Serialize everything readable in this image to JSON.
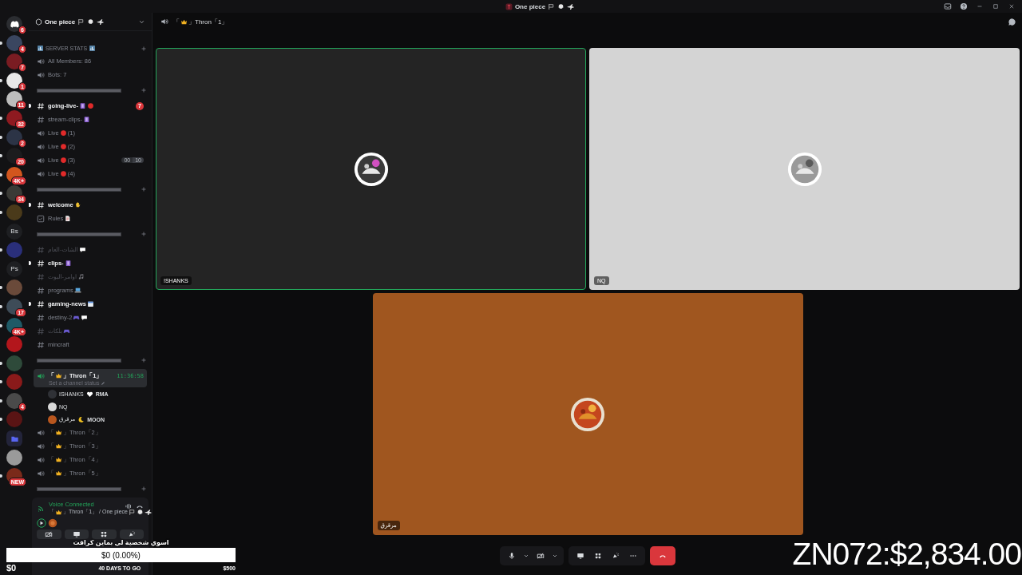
{
  "window": {
    "title": "One piece"
  },
  "servers": [
    {
      "kind": "home",
      "badge": "6",
      "unread": false,
      "color": "#2b2d31"
    },
    {
      "kind": "avatar",
      "badge": "4",
      "unread": true,
      "color": "#3a4660"
    },
    {
      "kind": "avatar",
      "badge": "7",
      "unread": false,
      "color": "#7a1c22"
    },
    {
      "kind": "avatar",
      "badge": "1",
      "unread": true,
      "color": "#e8e8e8"
    },
    {
      "kind": "avatar",
      "badge": "11",
      "unread": false,
      "color": "#bdbdbd"
    },
    {
      "kind": "avatar",
      "badge": "32",
      "unread": true,
      "color": "#8e1a20"
    },
    {
      "kind": "avatar",
      "badge": "2",
      "unread": true,
      "color": "#2c3446"
    },
    {
      "kind": "avatar",
      "badge": "20",
      "unread": true,
      "color": "#1c1c1e"
    },
    {
      "kind": "avatar",
      "badge": "4K+",
      "unread": true,
      "color": "#d2561e"
    },
    {
      "kind": "avatar",
      "badge": "34",
      "unread": true,
      "color": "#3a3a36"
    },
    {
      "kind": "avatar",
      "unread": true,
      "color": "#4a3a1a"
    },
    {
      "kind": "text",
      "label": "Bs",
      "unread": false,
      "color": "#1e1f22"
    },
    {
      "kind": "avatar",
      "unread": true,
      "color": "#2a2f7a"
    },
    {
      "kind": "text",
      "label": "Ps",
      "unread": false,
      "color": "#1e1f22"
    },
    {
      "kind": "avatar",
      "unread": true,
      "color": "#6a4a3a"
    },
    {
      "kind": "avatar",
      "badge": "17",
      "unread": true,
      "color": "#3e4c58"
    },
    {
      "kind": "avatar",
      "badge": "4K+",
      "unread": true,
      "color": "#1f5a66"
    },
    {
      "kind": "avatar",
      "unread": false,
      "color": "#b3161c"
    },
    {
      "kind": "avatar",
      "unread": true,
      "color": "#2e4a3a"
    },
    {
      "kind": "avatar",
      "unread": true,
      "color": "#8a1a1a"
    },
    {
      "kind": "avatar",
      "badge": "4",
      "unread": true,
      "color": "#4a4a4a"
    },
    {
      "kind": "avatar",
      "unread": true,
      "color": "#5a1414"
    },
    {
      "kind": "folder",
      "unread": false,
      "color": "#23243a"
    },
    {
      "kind": "avatar",
      "unread": false,
      "color": "#9a9a9a"
    },
    {
      "kind": "avatar",
      "badge": "NEW",
      "unread": true,
      "color": "#7a2a1a"
    }
  ],
  "sidebar": {
    "server_name": "One piece",
    "channels": [
      {
        "kind": "category",
        "texts": [
          "SERVER STATS"
        ]
      },
      {
        "kind": "voice",
        "unread": false,
        "muted": false,
        "texts": [
          "All Members: 86"
        ]
      },
      {
        "kind": "voice",
        "unread": false,
        "muted": false,
        "texts": [
          "Bots: 7"
        ]
      },
      {
        "kind": "divider"
      },
      {
        "kind": "text",
        "unread": true,
        "muted": false,
        "badge": "7",
        "texts": [
          "going-live-"
        ]
      },
      {
        "kind": "text",
        "unread": false,
        "muted": false,
        "texts": [
          "stream-clips-"
        ]
      },
      {
        "kind": "voice",
        "unread": false,
        "muted": false,
        "texts": [
          "Live",
          "(1)"
        ]
      },
      {
        "kind": "voice",
        "unread": false,
        "muted": false,
        "texts": [
          "Live",
          "(2)"
        ]
      },
      {
        "kind": "voice",
        "unread": false,
        "muted": false,
        "texts": [
          "Live",
          "(3)"
        ],
        "count": [
          "00",
          "10"
        ]
      },
      {
        "kind": "voice",
        "unread": false,
        "muted": false,
        "texts": [
          "Live",
          "(4)"
        ]
      },
      {
        "kind": "divider"
      },
      {
        "kind": "text",
        "unread": true,
        "muted": false,
        "texts": [
          "welcome"
        ]
      },
      {
        "kind": "rules",
        "unread": false,
        "muted": false,
        "texts": [
          "Rules"
        ]
      },
      {
        "kind": "divider"
      },
      {
        "kind": "text",
        "unread": false,
        "muted": true,
        "texts": [
          "الشات-العام"
        ]
      },
      {
        "kind": "text",
        "unread": true,
        "muted": false,
        "texts": [
          "clips-"
        ]
      },
      {
        "kind": "text",
        "unread": false,
        "muted": true,
        "texts": [
          "اوامر-البوت"
        ]
      },
      {
        "kind": "text",
        "unread": false,
        "muted": false,
        "texts": [
          "programs"
        ]
      },
      {
        "kind": "text",
        "unread": true,
        "muted": false,
        "texts": [
          "gaming-news"
        ]
      },
      {
        "kind": "text",
        "unread": false,
        "muted": false,
        "texts": [
          "destiny-2"
        ]
      },
      {
        "kind": "text",
        "unread": false,
        "muted": true,
        "texts": [
          "بلكات"
        ]
      },
      {
        "kind": "text",
        "unread": false,
        "muted": false,
        "texts": [
          "mincraft"
        ]
      },
      {
        "kind": "divider"
      },
      {
        "kind": "voice",
        "selected": true,
        "unread": true,
        "muted": false,
        "texts": [
          "「",
          "」Thron「1」"
        ],
        "time": "11:36:58",
        "status": "Set a channel status",
        "users": [
          {
            "name": "ISHANKS",
            "color": "#2f3136",
            "tag": "RMA"
          },
          {
            "name": "NQ",
            "color": "#d8d8d8"
          },
          {
            "name": "مرقرق",
            "color": "#b8561e",
            "tag": "MOON"
          }
        ]
      },
      {
        "kind": "voice",
        "selected": false,
        "unread": false,
        "muted": false,
        "texts": [
          "「",
          "」Thron「2」"
        ]
      },
      {
        "kind": "voice",
        "selected": false,
        "unread": false,
        "muted": false,
        "texts": [
          "「",
          "」Thron「3」"
        ]
      },
      {
        "kind": "voice",
        "selected": false,
        "unread": false,
        "muted": false,
        "texts": [
          "「",
          "」Thron「4」"
        ]
      },
      {
        "kind": "voice",
        "selected": false,
        "unread": false,
        "muted": false,
        "texts": [
          "「",
          "」Thron「5」"
        ]
      },
      {
        "kind": "divider"
      }
    ]
  },
  "voice_panel": {
    "title": "Voice Connected",
    "texts": [
      "「",
      "」Thron「1」 / One piece"
    ]
  },
  "main": {
    "texts": [
      "「",
      "」Thron「1」"
    ],
    "tiles": [
      {
        "name": "!SHANKS",
        "speaking": true,
        "color": "#242424"
      },
      {
        "name": "NQ",
        "speaking": false,
        "color": "#d4d4d4"
      },
      {
        "name": "مرقرق",
        "speaking": false,
        "color": "#a0561f"
      }
    ]
  },
  "overlay": {
    "goal_title": "اسوي شخصية لي بماين كرافت",
    "amount": "$0 (0.00%)",
    "level": 0,
    "start": "$0",
    "days_left": "40 DAYS TO GO",
    "goal": "$500",
    "ticker": "ZN072:$2,834.00"
  }
}
